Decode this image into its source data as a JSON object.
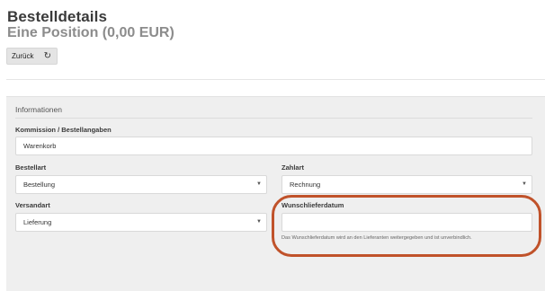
{
  "header": {
    "title": "Bestelldetails",
    "subtitle": "Eine Position (0,00 EUR)"
  },
  "toolbar": {
    "back_label": "Zurück",
    "refresh_icon": "refresh-icon"
  },
  "form": {
    "section_title": "Informationen",
    "commission": {
      "label": "Kommission / Bestellangaben",
      "value": "Warenkorb"
    },
    "order_type": {
      "label": "Bestellart",
      "value": "Bestellung"
    },
    "payment": {
      "label": "Zahlart",
      "value": "Rechnung"
    },
    "shipping": {
      "label": "Versandart",
      "value": "Lieferung"
    },
    "desired_date": {
      "label": "Wunschlieferdatum",
      "value": "",
      "hint": "Das Wunschlieferdatum wird an den Lieferanten weitergegeben und ist unverbindlich."
    }
  },
  "colors": {
    "highlight": "#c0522a",
    "panel_bg": "#efefef"
  }
}
